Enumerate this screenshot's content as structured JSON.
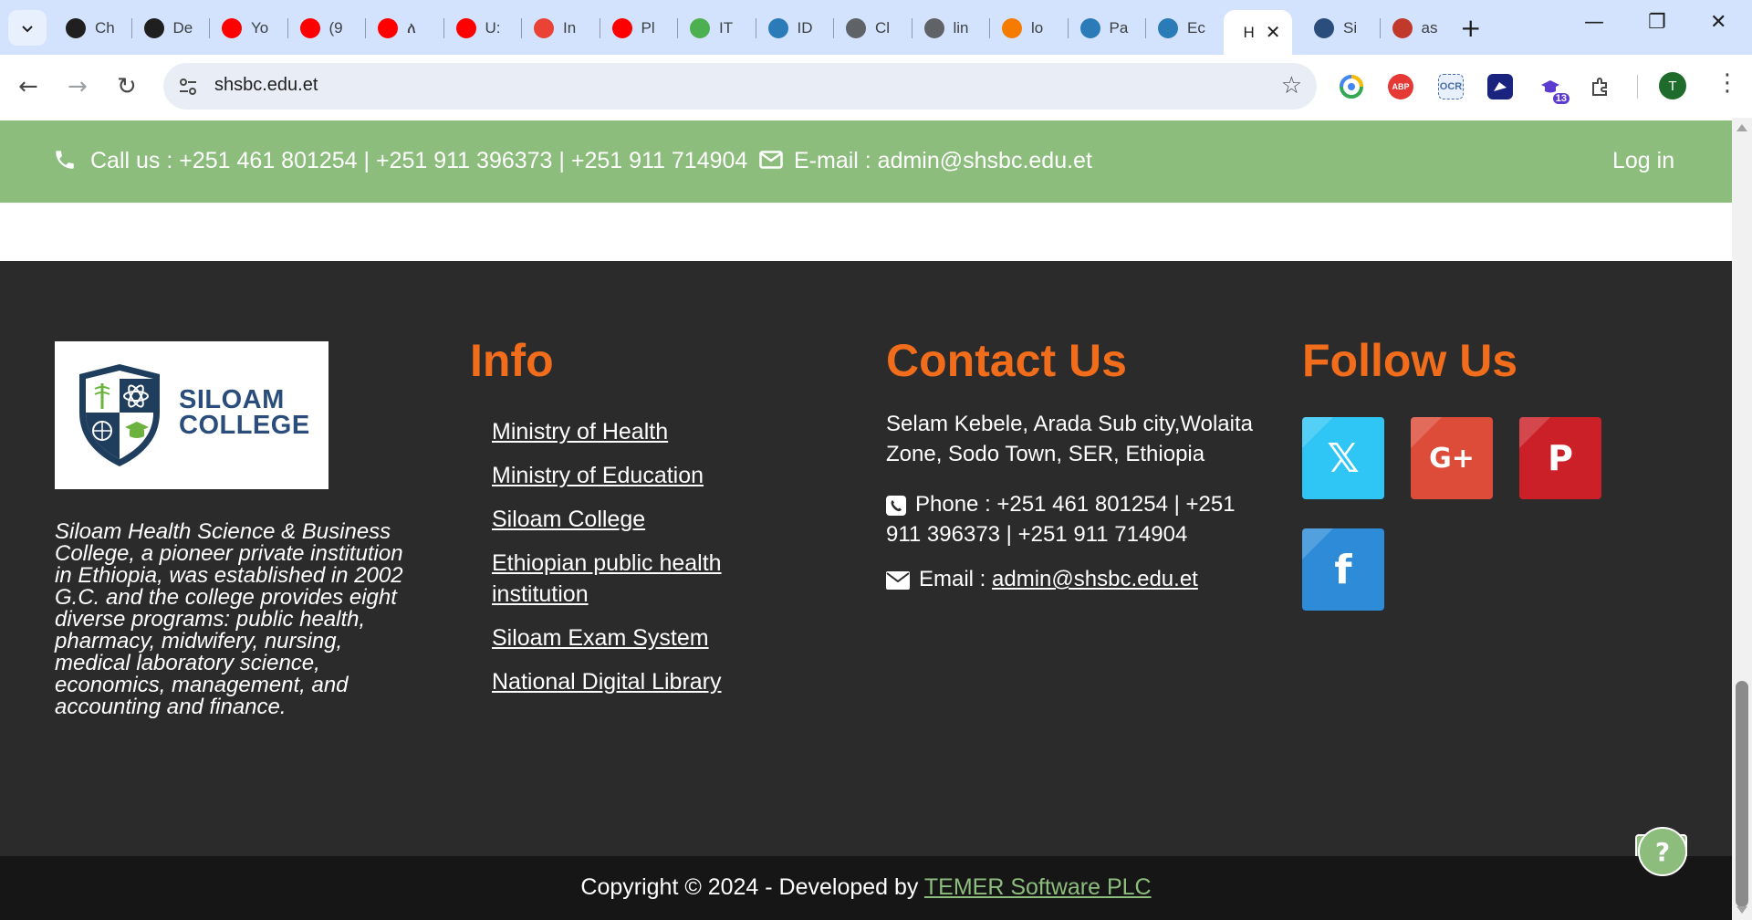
{
  "browser": {
    "tabs": [
      {
        "label": "Ch",
        "icon": "openai-icon",
        "color": "#1f1f1f"
      },
      {
        "label": "De",
        "icon": "deepseek-icon",
        "color": "#1f1f1f"
      },
      {
        "label": "Yo",
        "icon": "youtube-icon",
        "color": "#ff0000"
      },
      {
        "label": "(9",
        "icon": "youtube-icon",
        "color": "#ff0000"
      },
      {
        "label": "ለ",
        "icon": "youtube-icon",
        "color": "#ff0000"
      },
      {
        "label": "U:",
        "icon": "youtube-icon",
        "color": "#ff0000"
      },
      {
        "label": "In",
        "icon": "gmail-icon",
        "color": "#ea4335"
      },
      {
        "label": "Pl",
        "icon": "youtube-icon",
        "color": "#ff0000"
      },
      {
        "label": "IT",
        "icon": "arc-icon",
        "color": "#4caf50"
      },
      {
        "label": "ID",
        "icon": "xampp-icon",
        "color": "#2b7bb9"
      },
      {
        "label": "Cl",
        "icon": "globe-icon",
        "color": "#5f6368"
      },
      {
        "label": "lin",
        "icon": "globe-icon",
        "color": "#5f6368"
      },
      {
        "label": "lo",
        "icon": "xampp-orange-icon",
        "color": "#f57c00"
      },
      {
        "label": "Pa",
        "icon": "xampp-icon",
        "color": "#2b7bb9"
      },
      {
        "label": "Ec",
        "icon": "xampp-icon",
        "color": "#2b7bb9"
      },
      {
        "label": "H",
        "icon": "page-icon",
        "color": "#ffffff",
        "active": true
      },
      {
        "label": "Si",
        "icon": "shield-icon",
        "color": "#2a4d7c"
      },
      {
        "label": "as",
        "icon": "people-icon",
        "color": "#c0392b"
      }
    ],
    "new_tab": "+",
    "url": "shsbc.edu.et",
    "extensions": [
      {
        "name": "chrome-color-icon",
        "text": "",
        "color": "#ffffff"
      },
      {
        "name": "adblock-icon",
        "text": "ABP",
        "color": "#e53935"
      },
      {
        "name": "ocr-icon",
        "text": "OCR",
        "color": "#e8f0fe"
      },
      {
        "name": "image-extension-icon",
        "text": "",
        "color": "#1a237e"
      },
      {
        "name": "graduation-extension-icon",
        "text": "13",
        "color": "#5c3bd1"
      },
      {
        "name": "puzzle-icon",
        "text": "",
        "color": "#ffffff"
      }
    ],
    "profile_initial": "T"
  },
  "topbar": {
    "call": "Call us : +251 461 801254 | +251 911 396373 | +251 911 714904",
    "email": "E-mail : admin@shsbc.edu.et",
    "login": "Log in"
  },
  "footer": {
    "logo_line1": "SILOAM",
    "logo_line2": "COLLEGE",
    "about": "Siloam Health Science & Business College, a pioneer private institution in Ethiopia, was established in 2002 G.C. and the college provides eight diverse programs: public health, pharmacy, midwifery, nursing, medical laboratory science, economics, management, and accounting and finance.",
    "info_title": "Info",
    "info_links": [
      "Ministry of Health",
      "Ministry of Education",
      "Siloam College",
      "Ethiopian public health institution",
      "Siloam Exam System",
      "National Digital Library"
    ],
    "contact_title": "Contact Us",
    "address": "Selam Kebele, Arada Sub city,Wolaita Zone, Sodo Town, SER, Ethiopia",
    "phone": "Phone : +251 461 801254 | +251 911 396373 | +251 911 714904",
    "email_label": "Email : ",
    "email_link": "admin@shsbc.edu.et",
    "follow_title": "Follow Us",
    "social": [
      {
        "name": "x",
        "glyph": "𝕏",
        "color": "#2fc6f6"
      },
      {
        "name": "google-plus",
        "glyph": "G+",
        "color": "#dd4b39"
      },
      {
        "name": "pinterest",
        "glyph": "P",
        "color": "#cb2027"
      },
      {
        "name": "facebook",
        "glyph": "f",
        "color": "#2e8bd8"
      }
    ],
    "help": "?"
  },
  "copyright": {
    "text": "Copyright © 2024 - Developed by ",
    "link": "TEMER Software PLC"
  },
  "colors": {
    "accent_green": "#8dbd7d",
    "heading_orange": "#f26d1b",
    "footer_bg": "#2b2b2b",
    "copyright_bg": "#161616"
  }
}
